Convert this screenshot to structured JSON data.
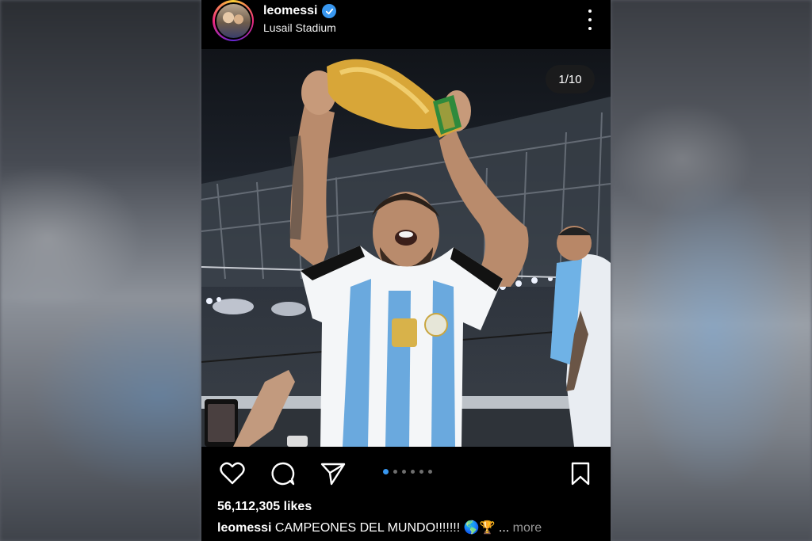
{
  "post": {
    "username": "leomessi",
    "location": "Lusail Stadium",
    "counter": "1/10",
    "likes": "56,112,305 likes",
    "caption_user": "leomessi",
    "caption_text": " CAMPEONES DEL MUNDO!!!!!!! 🌎🏆 ...",
    "caption_more": " more",
    "carousel": {
      "total": 6,
      "active_index": 0
    }
  },
  "icons": {
    "verified": "verified-badge-icon",
    "more": "more-options-icon",
    "like": "heart-icon",
    "comment": "comment-icon",
    "share": "paper-plane-icon",
    "save": "bookmark-icon"
  },
  "colors": {
    "accent": "#3897f0",
    "background": "#000000"
  }
}
